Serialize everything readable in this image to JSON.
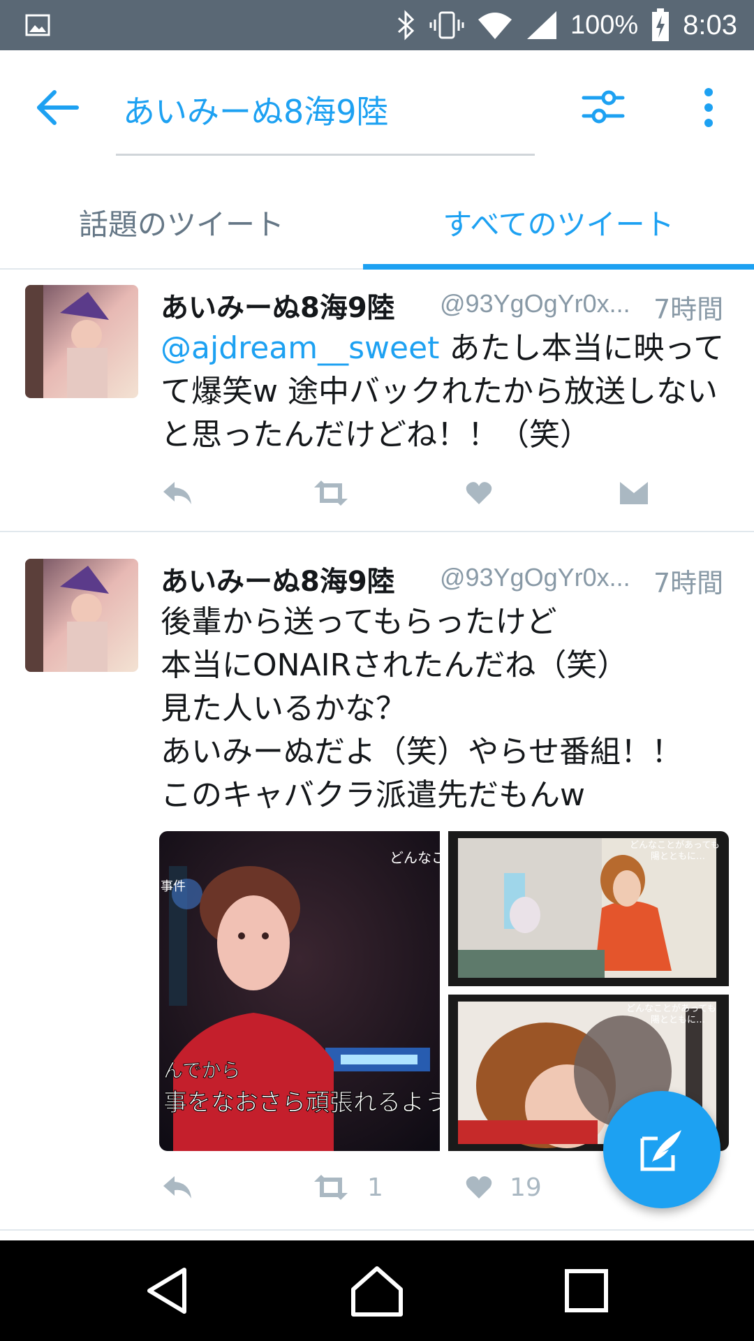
{
  "status_bar": {
    "battery": "100%",
    "time": "8:03"
  },
  "header": {
    "search_title": "あいみーぬ8海9陸"
  },
  "tabs": {
    "top": "話題のツイート",
    "all": "すべてのツイート"
  },
  "tweets": [
    {
      "name": "あいみーぬ8海9陸",
      "handle": "@93YgOgYr0x...",
      "time": "7時間",
      "mention": "@ajdream__sweet",
      "text": " あたし本当に映ってて爆笑w 途中バックれたから放送しないと思ったんだけどね！！（笑）",
      "retweets": "",
      "likes": ""
    },
    {
      "name": "あいみーぬ8海9陸",
      "handle": "@93YgOgYr0x...",
      "time": "7時間",
      "lines": [
        "後輩から送ってもらったけど",
        "本当にONAIRされたんだね（笑）",
        "見た人いるかな？",
        "あいみーぬだよ（笑）やらせ番組！！",
        "このキャバクラ派遣先だもんw"
      ],
      "media_captions": {
        "main_top": "どんなこ",
        "main_side": "事件",
        "main_sub1": "んでから",
        "main_sub2": "事をなおさら頑張れるように",
        "tr_caption": "どんなことがあっても",
        "tr_caption2": "陽とともに…",
        "br_caption": "どんなことがあっても",
        "br_caption2": "陽とともに…"
      },
      "retweets": "1",
      "likes": "19"
    }
  ],
  "colors": {
    "accent": "#1da1f2",
    "status_bar": "#5a6875",
    "muted": "#8899a6"
  }
}
